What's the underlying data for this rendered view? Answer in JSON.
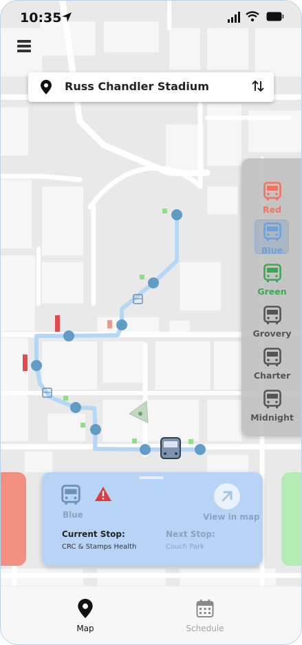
{
  "status_bar": {
    "time": "10:35"
  },
  "search": {
    "value": "Russ Chandler Stadium"
  },
  "routes": [
    {
      "label": "Red",
      "color": "#f07360"
    },
    {
      "label": "Blue",
      "color": "#6aa2df",
      "selected": true
    },
    {
      "label": "Green",
      "color": "#3aaa50"
    },
    {
      "label": "Grovery",
      "color": "#555555"
    },
    {
      "label": "Charter",
      "color": "#555555"
    },
    {
      "label": "Midnight",
      "color": "#555555"
    }
  ],
  "card": {
    "route_name": "Blue",
    "view_label": "View in map",
    "current_stop_label": "Current Stop:",
    "current_stop_value": "CRC & Stamps Health",
    "next_stop_label": "Next Stop:",
    "next_stop_value": "Couch Park"
  },
  "tabs": [
    {
      "label": "Map",
      "active": true
    },
    {
      "label": "Schedule",
      "active": false
    }
  ],
  "colors": {
    "route_line": "#b3d7f4",
    "stop": "#5f9cc6",
    "card": "#b7d4f6",
    "accent_red": "#e05a5a"
  }
}
